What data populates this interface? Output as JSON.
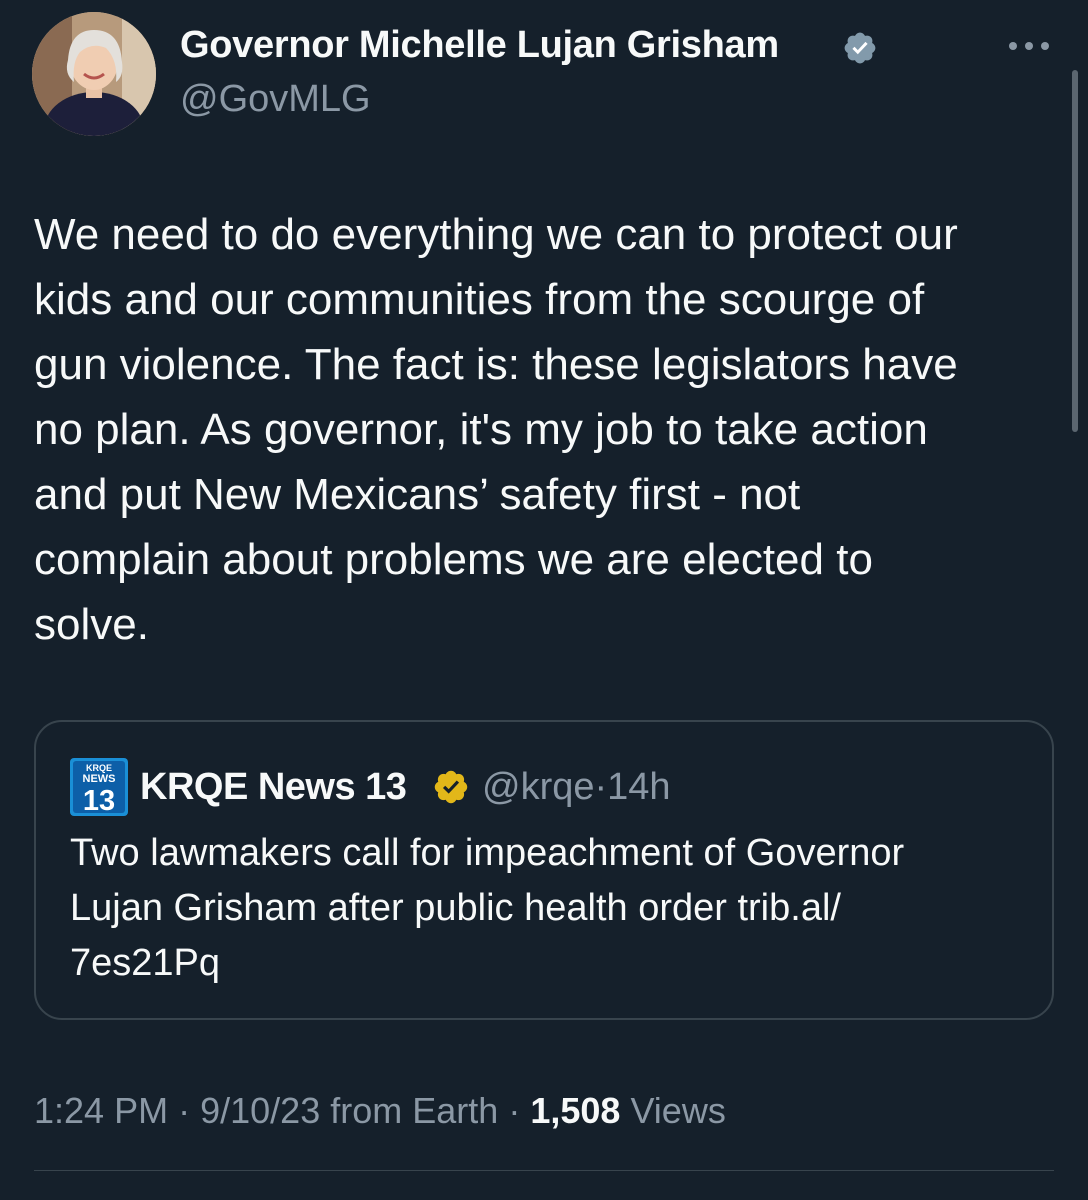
{
  "tweet": {
    "author": {
      "display_name": "Governor Michelle Lujan Grisham",
      "handle": "@GovMLG",
      "avatar_icon": "profile-photo",
      "verified_badge": "gray"
    },
    "text_lines": [
      "We need to do everything we can to protect our",
      "kids and our communities from the scourge of",
      "gun violence. The fact is: these legislators have",
      "no plan. As governor, it's my job to take action",
      "and put New Mexicans’ safety first - not",
      "complain about problems we are elected to",
      "solve."
    ],
    "more_icon": "ellipsis-icon"
  },
  "quoted_tweet": {
    "display_name": "KRQE News 13",
    "handle": "@krqe",
    "separator": "·",
    "time": "14h",
    "logo_text_top": "KRQE",
    "logo_text_mid": "NEWS",
    "logo_text_num": "13",
    "verified_badge": "gold",
    "text_lines": [
      "Two lawmakers call for impeachment of Governor",
      "Lujan Grisham after public health order trib.al/",
      "7es21Pq"
    ]
  },
  "meta": {
    "time": "1:24 PM",
    "sep1": "·",
    "date": "9/10/23",
    "source": "from Earth",
    "sep2": "·",
    "views_count": "1,508",
    "views_label": "Views"
  },
  "colors": {
    "background": "#15202b",
    "text": "#f7f9f9",
    "secondary": "#8b98a5",
    "border": "#38444d",
    "gold": "#e2b719",
    "gray_badge": "#829aab"
  }
}
